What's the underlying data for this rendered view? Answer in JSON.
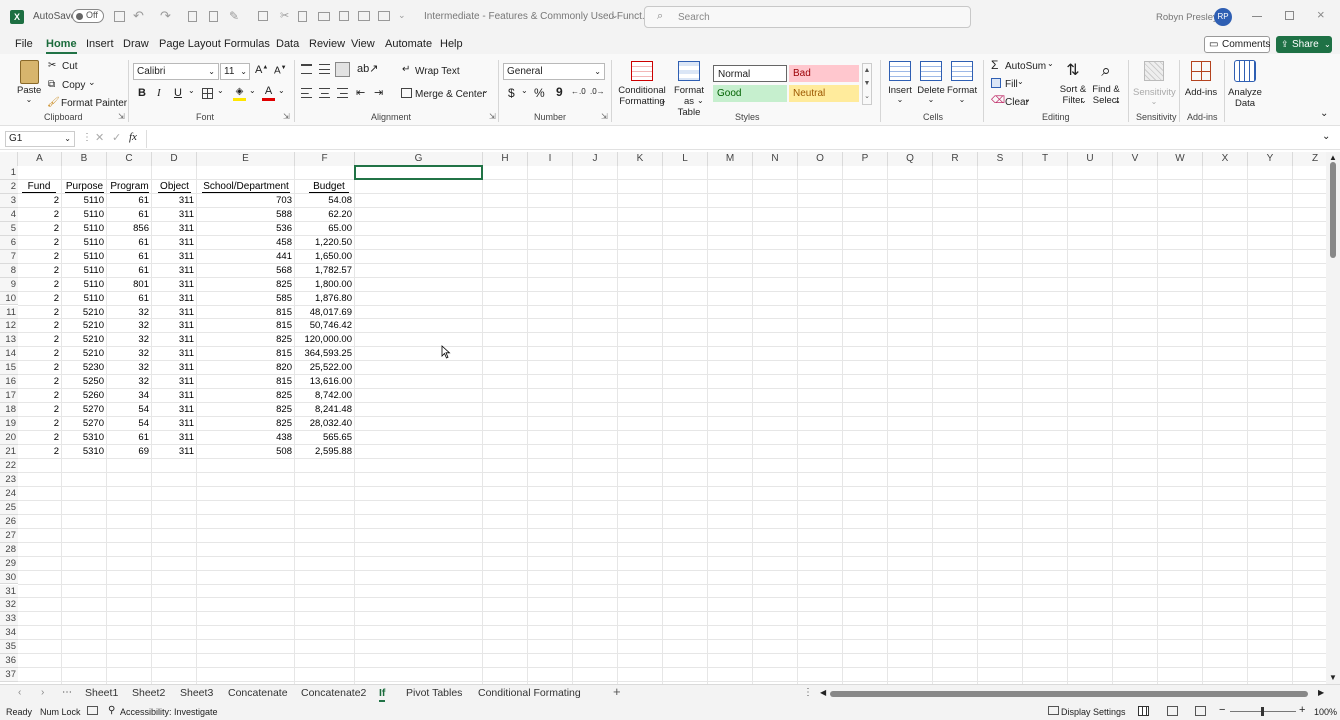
{
  "titlebar": {
    "autosave_label": "AutoSave",
    "autosave_state": "Off",
    "doc_title": "Intermediate - Features & Commonly Used Funct...",
    "search_placeholder": "Search",
    "user_name": "Robyn Presley",
    "user_initials": "RP"
  },
  "menu": {
    "tabs": [
      "File",
      "Home",
      "Insert",
      "Draw",
      "Page Layout",
      "Formulas",
      "Data",
      "Review",
      "View",
      "Automate",
      "Help"
    ],
    "active": "Home",
    "comments": "Comments",
    "share": "Share"
  },
  "ribbon": {
    "clipboard": {
      "paste": "Paste",
      "cut": "Cut",
      "copy": "Copy",
      "format_painter": "Format Painter",
      "label": "Clipboard"
    },
    "font": {
      "name": "Calibri",
      "size": "11",
      "bold": "B",
      "italic": "I",
      "underline": "U",
      "label": "Font"
    },
    "alignment": {
      "wrap": "Wrap Text",
      "merge": "Merge & Center",
      "label": "Alignment"
    },
    "number": {
      "format": "General",
      "label": "Number"
    },
    "styles": {
      "cond_format_1": "Conditional",
      "cond_format_2": "Formatting",
      "format_table_1": "Format as",
      "format_table_2": "Table",
      "normal": "Normal",
      "bad": "Bad",
      "good": "Good",
      "neutral": "Neutral",
      "label": "Styles"
    },
    "cells": {
      "insert": "Insert",
      "delete": "Delete",
      "format": "Format",
      "label": "Cells"
    },
    "editing": {
      "autosum": "AutoSum",
      "fill": "Fill",
      "clear": "Clear",
      "sort_1": "Sort &",
      "sort_2": "Filter",
      "find_1": "Find &",
      "find_2": "Select",
      "label": "Editing"
    },
    "sensitivity": {
      "btn": "Sensitivity",
      "label": "Sensitivity"
    },
    "addins": {
      "btn": "Add-ins",
      "label": "Add-ins"
    },
    "analyze": {
      "line1": "Analyze",
      "line2": "Data"
    }
  },
  "formula_bar": {
    "name_box": "G1",
    "fx": "fx",
    "value": ""
  },
  "columns": [
    "A",
    "B",
    "C",
    "D",
    "E",
    "F",
    "G",
    "H",
    "I",
    "J",
    "K",
    "L",
    "M",
    "N",
    "O",
    "P",
    "Q",
    "R",
    "S",
    "T",
    "U",
    "V",
    "W",
    "X",
    "Y",
    "Z"
  ],
  "row_count": 37,
  "table": {
    "headers": [
      "Fund",
      "Purpose",
      "Program",
      "Object",
      "School/Department",
      "Budget"
    ],
    "rows": [
      [
        "2",
        "5110",
        "61",
        "311",
        "703",
        "54.08"
      ],
      [
        "2",
        "5110",
        "61",
        "311",
        "588",
        "62.20"
      ],
      [
        "2",
        "5110",
        "856",
        "311",
        "536",
        "65.00"
      ],
      [
        "2",
        "5110",
        "61",
        "311",
        "458",
        "1,220.50"
      ],
      [
        "2",
        "5110",
        "61",
        "311",
        "441",
        "1,650.00"
      ],
      [
        "2",
        "5110",
        "61",
        "311",
        "568",
        "1,782.57"
      ],
      [
        "2",
        "5110",
        "801",
        "311",
        "825",
        "1,800.00"
      ],
      [
        "2",
        "5110",
        "61",
        "311",
        "585",
        "1,876.80"
      ],
      [
        "2",
        "5210",
        "32",
        "311",
        "815",
        "48,017.69"
      ],
      [
        "2",
        "5210",
        "32",
        "311",
        "815",
        "50,746.42"
      ],
      [
        "2",
        "5210",
        "32",
        "311",
        "825",
        "120,000.00"
      ],
      [
        "2",
        "5210",
        "32",
        "311",
        "815",
        "364,593.25"
      ],
      [
        "2",
        "5230",
        "32",
        "311",
        "820",
        "25,522.00"
      ],
      [
        "2",
        "5250",
        "32",
        "311",
        "815",
        "13,616.00"
      ],
      [
        "2",
        "5260",
        "34",
        "311",
        "825",
        "8,742.00"
      ],
      [
        "2",
        "5270",
        "54",
        "311",
        "825",
        "8,241.48"
      ],
      [
        "2",
        "5270",
        "54",
        "311",
        "825",
        "28,032.40"
      ],
      [
        "2",
        "5310",
        "61",
        "311",
        "438",
        "565.65"
      ],
      [
        "2",
        "5310",
        "69",
        "311",
        "508",
        "2,595.88"
      ]
    ]
  },
  "sheets": [
    "Sheet1",
    "Sheet2",
    "Sheet3",
    "Concatenate",
    "Concatenate2",
    "If",
    "Pivot Tables",
    "Conditional Formating"
  ],
  "active_sheet": "If",
  "status": {
    "ready": "Ready",
    "numlock": "Num Lock",
    "accessibility": "Accessibility: Investigate",
    "display": "Display Settings",
    "zoom": "100%"
  }
}
